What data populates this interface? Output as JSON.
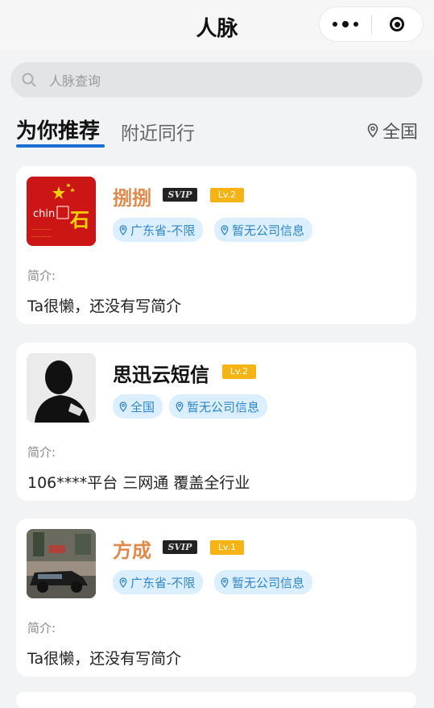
{
  "header": {
    "title": "人脉"
  },
  "search": {
    "placeholder": "人脉查询"
  },
  "tabs": {
    "active": "为你推荐",
    "other": "附近同行",
    "location": "全国"
  },
  "intro_label": "简介:",
  "cards": [
    {
      "name": "捌捌",
      "svip": "SVIP",
      "level": "Lv.2",
      "tags": [
        "广东省-不限",
        "暂无公司信息"
      ],
      "intro": "Ta很懒，还没有写简介",
      "avatar_text": "石"
    },
    {
      "name": "思迅云短信",
      "level": "Lv.2",
      "tags": [
        "全国",
        "暂无公司信息"
      ],
      "intro": "106****平台 三网通 覆盖全行业"
    },
    {
      "name": "方成",
      "svip": "SVIP",
      "level": "Lv.1",
      "tags": [
        "广东省-不限",
        "暂无公司信息"
      ],
      "intro": "Ta很懒，还没有写简介"
    }
  ],
  "colors": {
    "accent": "#1a6fd0",
    "tag_bg": "#dcefff",
    "tag_text": "#2f86c8",
    "name_orange": "#e0894a",
    "level_bg": "#f6b414"
  }
}
